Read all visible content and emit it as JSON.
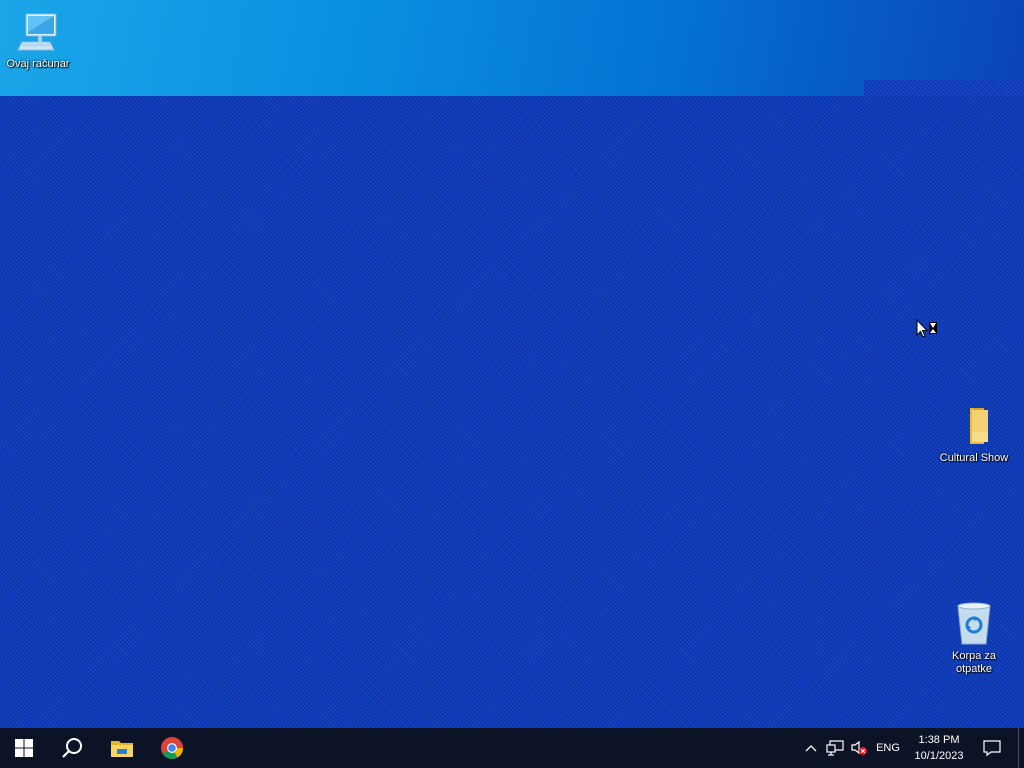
{
  "desktop": {
    "icons": [
      {
        "label": "Ovaj računar",
        "icon": "this-pc-icon"
      },
      {
        "label": "Cultural Show",
        "icon": "folder-icon"
      },
      {
        "label": "Korpa za otpatke",
        "icon": "recycle-bin-icon"
      }
    ],
    "cursor": "busy-arrow-cursor"
  },
  "taskbar": {
    "start_icon": "windows-logo-icon",
    "search_icon": "search-icon",
    "pinned": [
      {
        "name": "File Explorer",
        "icon": "file-explorer-icon"
      },
      {
        "name": "Google Chrome",
        "icon": "chrome-icon"
      }
    ],
    "tray": {
      "show_hidden_icon": "chevron-up-icon",
      "network_icon": "network-icon",
      "volume_icon": "volume-muted-icon",
      "language": "ENG",
      "time": "1:38 PM",
      "date": "10/1/2023",
      "notifications_icon": "action-center-icon"
    }
  },
  "colors": {
    "desktop_bg": "#0c3ab8",
    "taskbar_bg": "#0d1326",
    "accent": "#0a8fe0"
  }
}
